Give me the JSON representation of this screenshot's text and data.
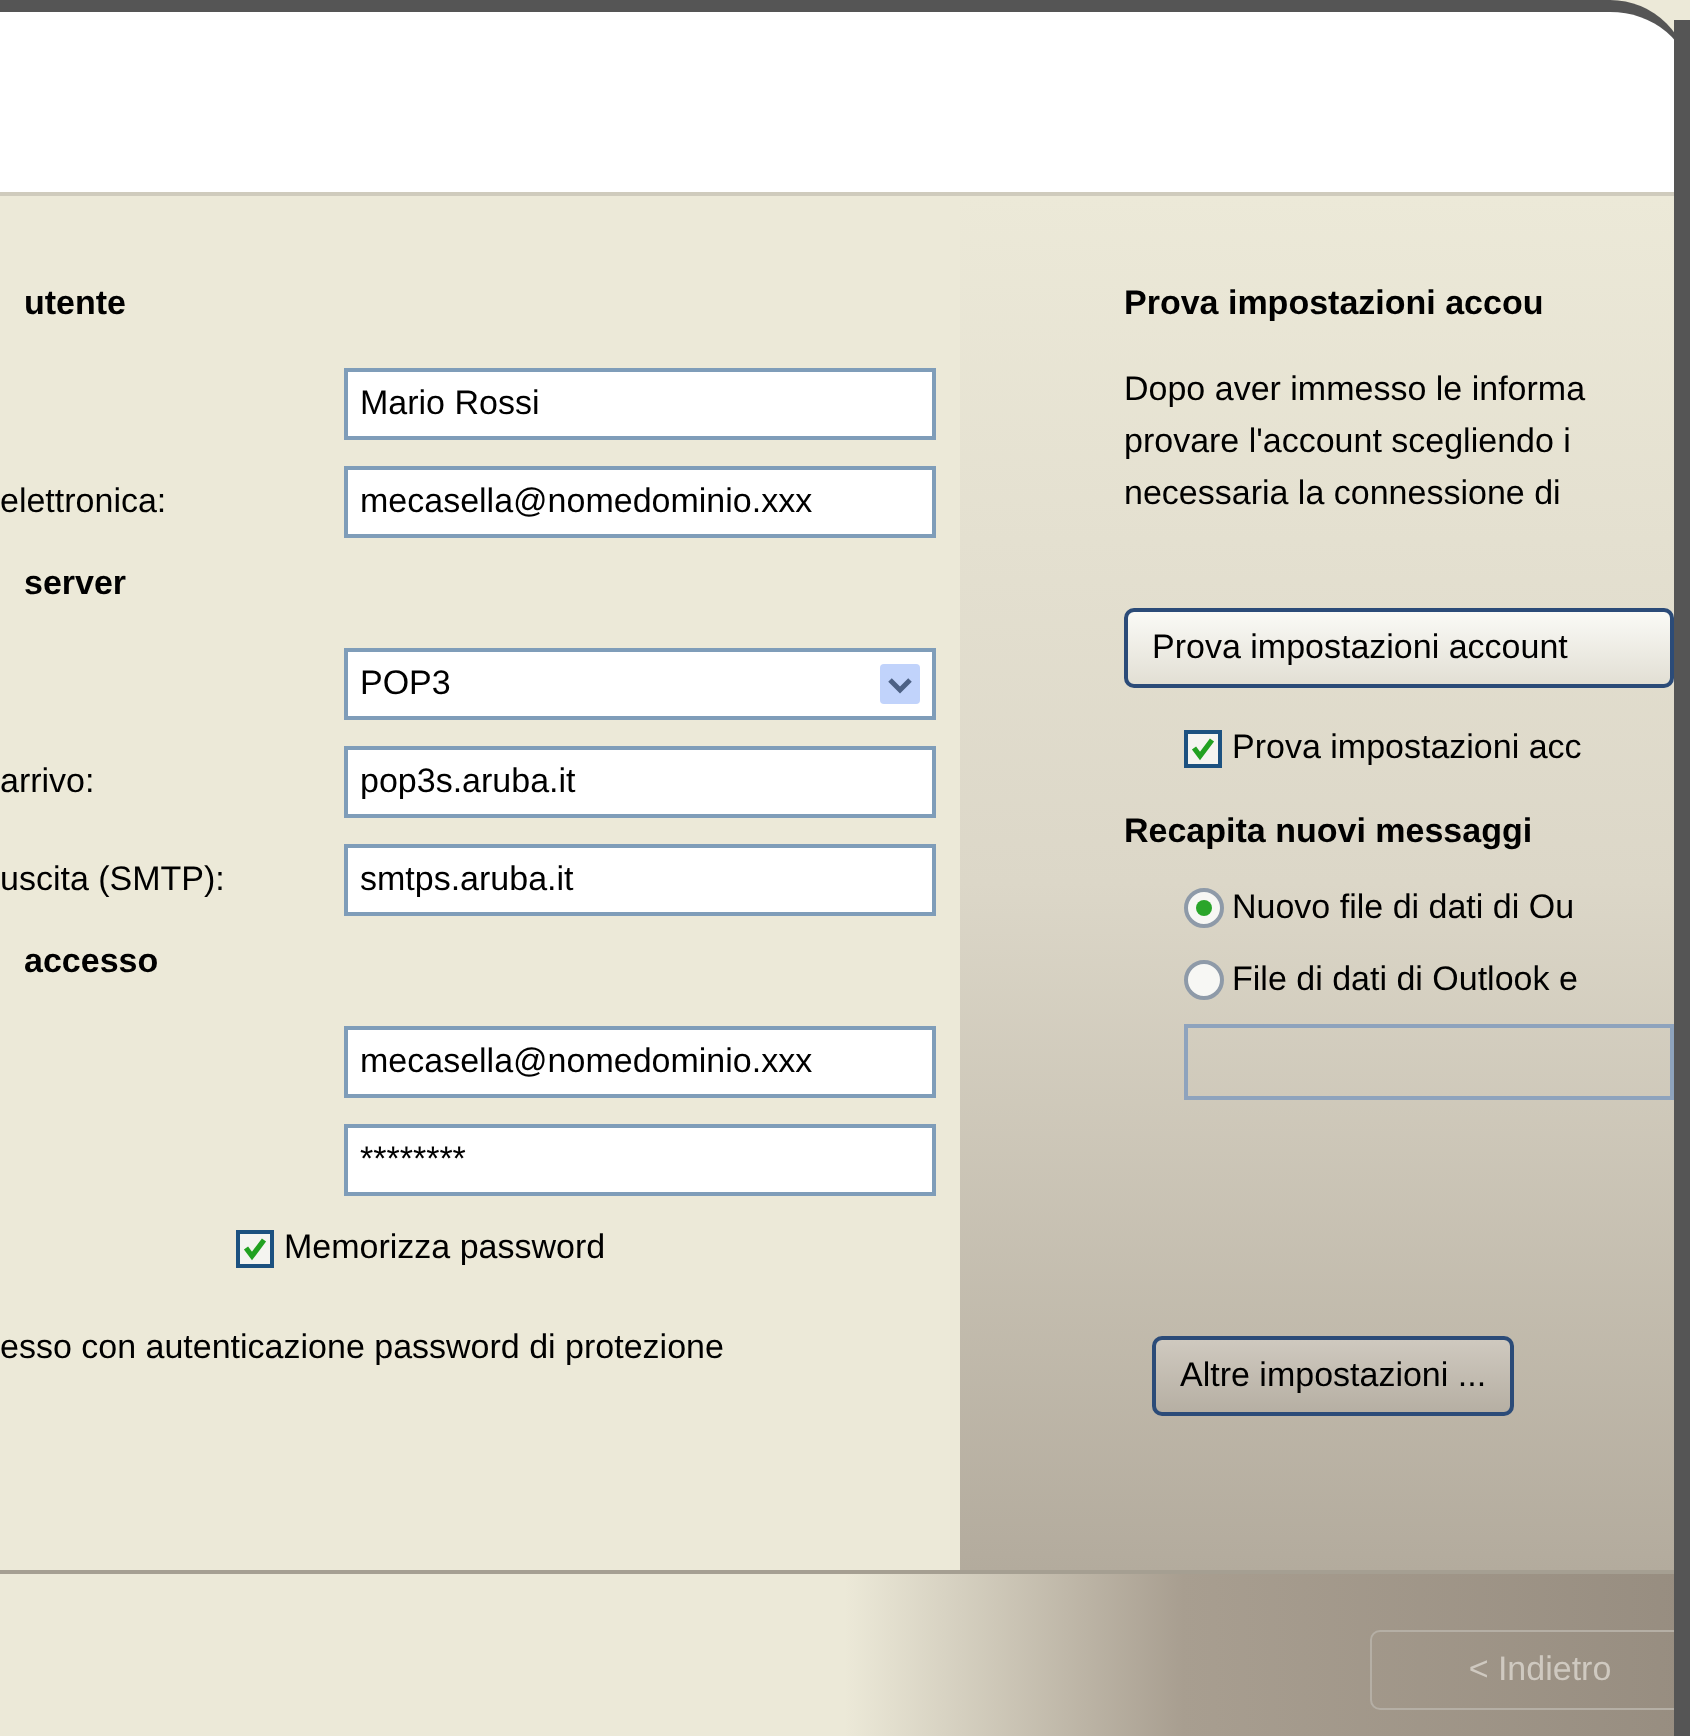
{
  "left": {
    "sections": [
      {
        "heading": "utente",
        "rows": [
          {
            "kind": "text",
            "label": "",
            "value": "Mario Rossi"
          },
          {
            "kind": "text",
            "label": "elettronica:",
            "value": "mecasella@nomedominio.xxx"
          }
        ]
      },
      {
        "heading": "server",
        "rows": [
          {
            "kind": "select",
            "label": "",
            "value": "POP3"
          },
          {
            "kind": "text",
            "label": "arrivo:",
            "value": "pop3s.aruba.it"
          },
          {
            "kind": "text",
            "label": "uscita (SMTP):",
            "value": "smtps.aruba.it"
          }
        ]
      },
      {
        "heading": "accesso",
        "rows": [
          {
            "kind": "text",
            "label": "",
            "value": "mecasella@nomedominio.xxx"
          },
          {
            "kind": "text",
            "label": "",
            "value": "********"
          }
        ]
      }
    ],
    "remember": {
      "label": "Memorizza password",
      "checked": true
    },
    "spa_text": "esso con autenticazione password di protezione"
  },
  "right": {
    "title": "Prova impostazioni accou",
    "description": [
      "Dopo aver immesso le informa",
      "provare l'account scegliendo i",
      "necessaria la connessione di"
    ],
    "test_button": "Prova impostazioni account",
    "test_check": {
      "label": "Prova impostazioni acc",
      "checked": true
    },
    "deliver_heading": "Recapita nuovi messaggi",
    "options": [
      {
        "label": "Nuovo file di dati di Ou",
        "selected": true
      },
      {
        "label": "File di dati di Outlook e",
        "selected": false
      }
    ],
    "more_button": "Altre impostazioni ..."
  },
  "footer": {
    "back_button": {
      "label": "< Indietro",
      "disabled": true
    }
  }
}
